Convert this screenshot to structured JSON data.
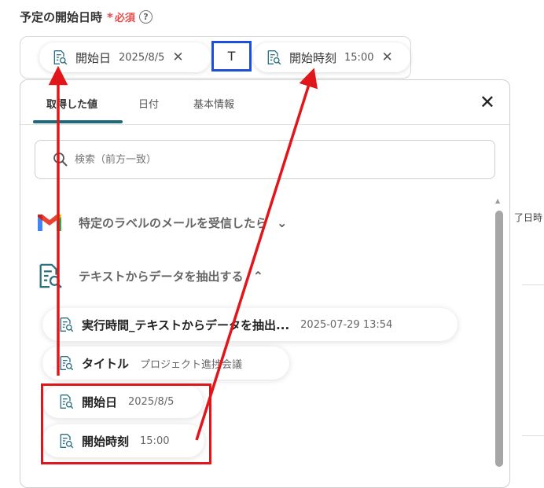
{
  "field": {
    "label": "予定の開始日時",
    "required_star": "*",
    "required_text": "必須",
    "help": "?"
  },
  "input": {
    "chip1": {
      "label": "開始日",
      "value": "2025/8/5",
      "close": "✕",
      "icon": "document-search-icon"
    },
    "t_char": "T",
    "chip2": {
      "label": "開始時刻",
      "value": "15:00",
      "close": "✕",
      "icon": "document-search-icon"
    }
  },
  "panel": {
    "tabs": [
      {
        "label": "取得した値",
        "active": true
      },
      {
        "label": "日付",
        "active": false
      },
      {
        "label": "基本情報",
        "active": false
      }
    ],
    "close": "✕",
    "search_placeholder": "検索（前方一致）",
    "sections": [
      {
        "title": "特定のラベルのメールを受信したら",
        "icon": "gmail-icon",
        "chevron": "⌄"
      },
      {
        "title": "テキストからデータを抽出する",
        "icon": "document-search-icon",
        "chevron": "⌃"
      }
    ],
    "items": [
      {
        "name": "実行時間_テキストからデータを抽出...",
        "value": "2025-07-29 13:54"
      },
      {
        "name": "タイトル",
        "value": "プロジェクト進捗会議"
      },
      {
        "name": "開始日",
        "value": "2025/8/5"
      },
      {
        "name": "開始時刻",
        "value": "15:00"
      }
    ]
  },
  "background": {
    "partial_text": "了日時"
  },
  "colors": {
    "required": "#e94b4b",
    "tab_accent": "#1c6a7c",
    "highlight_blue": "#1e4fd8",
    "annotation_red": "#e0161b",
    "icon_teal": "#2b6f82"
  }
}
